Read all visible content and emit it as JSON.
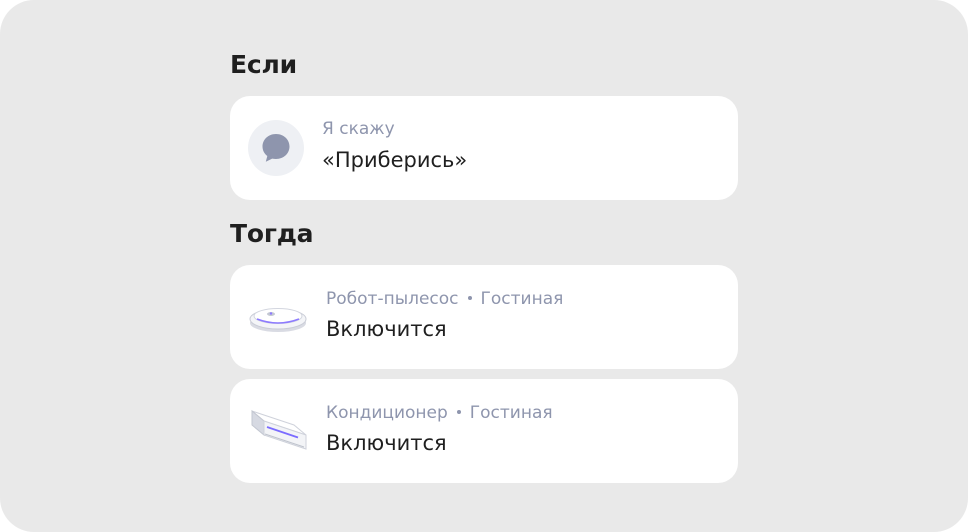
{
  "if_section": {
    "title": "Если",
    "trigger": {
      "icon": "speech-bubble-icon",
      "label": "Я скажу",
      "phrase": "«Приберись»"
    }
  },
  "then_section": {
    "title": "Тогда",
    "actions": [
      {
        "icon": "robot-vacuum-icon",
        "device": "Робот-пылесос",
        "room": "Гостиная",
        "action": "Включится"
      },
      {
        "icon": "air-conditioner-icon",
        "device": "Кондиционер",
        "room": "Гостиная",
        "action": "Включится"
      }
    ]
  },
  "colors": {
    "background": "#e9e9e9",
    "card": "#ffffff",
    "secondary_text": "#8e95ad",
    "primary_text": "#1f1f1f",
    "icon_circle": "#eef0f4",
    "icon_fill": "#8e95ad",
    "accent_led": "#7b6cff"
  }
}
